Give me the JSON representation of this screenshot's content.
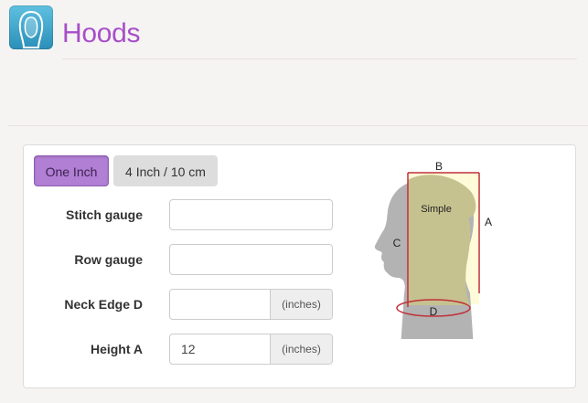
{
  "header": {
    "title": "Hoods",
    "icon": "hood-icon"
  },
  "tabs": [
    {
      "label": "One Inch",
      "active": true
    },
    {
      "label": "4 Inch / 10 cm",
      "active": false
    }
  ],
  "form": {
    "stitch_gauge": {
      "label": "Stitch gauge",
      "value": ""
    },
    "row_gauge": {
      "label": "Row gauge",
      "value": ""
    },
    "neck_edge": {
      "label": "Neck Edge D",
      "value": "",
      "unit": "(inches)"
    },
    "height": {
      "label": "Height A",
      "value": "12",
      "unit": "(inches)"
    }
  },
  "diagram": {
    "style_label": "Simple",
    "label_a": "A",
    "label_b": "B",
    "label_c": "C",
    "label_d": "D"
  },
  "colors": {
    "accent": "#a84fc9",
    "tab_active": "#b17fd4",
    "hood_fill": "#c6c28f",
    "measure_line": "#c0303a"
  }
}
